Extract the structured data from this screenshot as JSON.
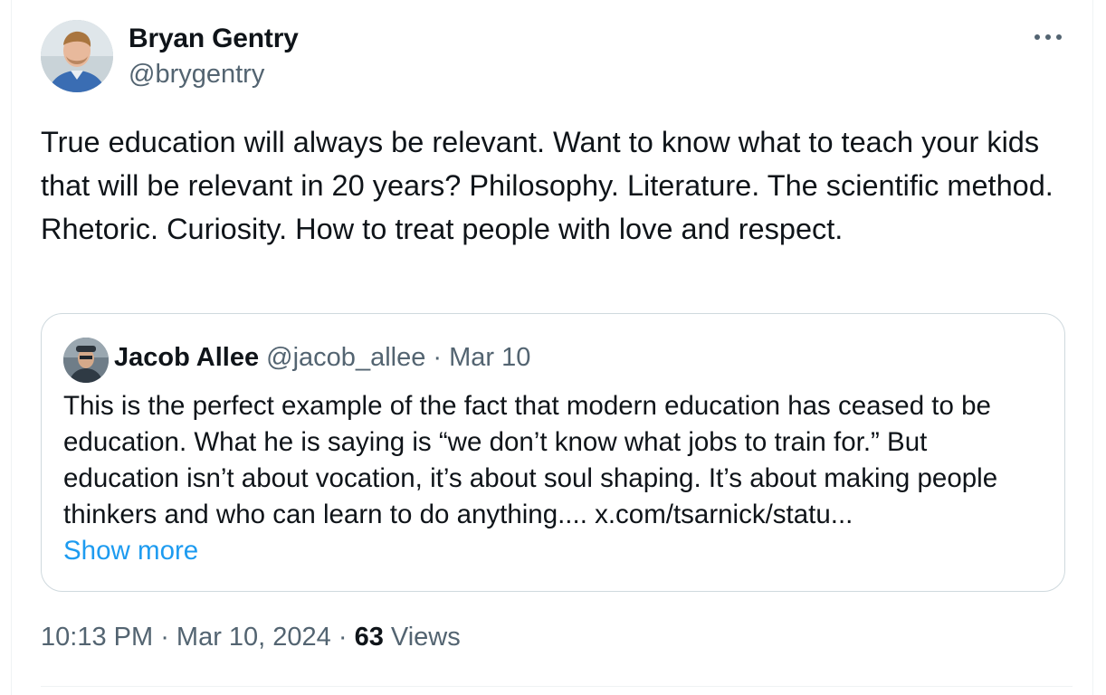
{
  "tweet": {
    "author": {
      "name": "Bryan Gentry",
      "handle": "@brygentry"
    },
    "more_icon": "more-horizontal-icon",
    "text": "True education will always be relevant. Want to know what to teach your kids that will be relevant in 20 years? Philosophy. Literature. The scientific method. Rhetoric. Curiosity. How to treat people with love and respect.",
    "quoted": {
      "name": "Jacob Allee",
      "handle": "@jacob_allee",
      "separator": " · ",
      "date": "Mar 10",
      "text": "This is the perfect example of the fact that modern education has ceased to be education. What he is saying is “we don’t know what jobs to train for.” But education isn’t about vocation, it’s about soul shaping. It’s about making people thinkers and who can learn to do anything.... x.com/tsarnick/statu...",
      "show_more": "Show more"
    },
    "footer": {
      "time": "10:13 PM",
      "sep1": " · ",
      "date": "Mar 10, 2024",
      "sep2": " · ",
      "views_count": "63",
      "views_label": " Views"
    }
  },
  "colors": {
    "primary_text": "#0f1419",
    "secondary_text": "#536471",
    "link": "#1d9bf0",
    "border": "#cfd9de"
  }
}
